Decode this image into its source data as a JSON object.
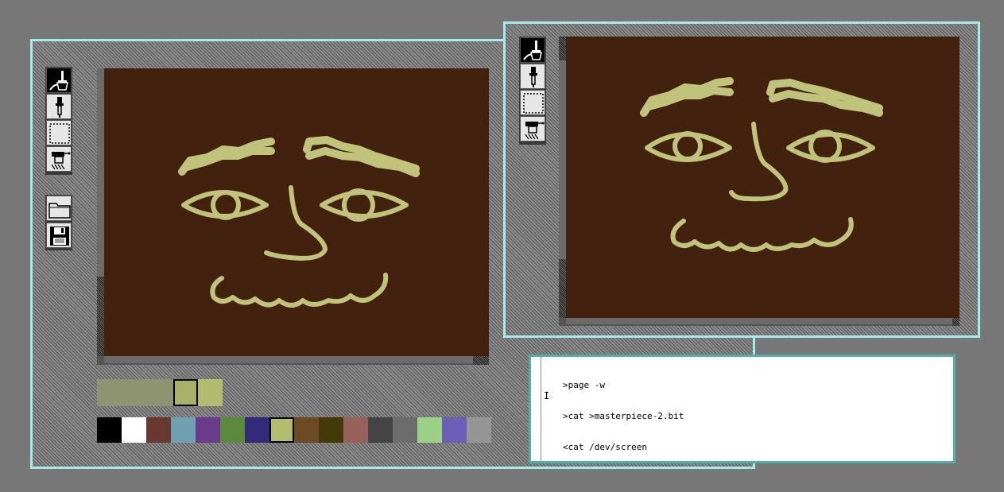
{
  "windows": {
    "left": {
      "tools": [
        {
          "icon": "paintbrush-icon",
          "selected": true
        },
        {
          "icon": "eyedropper-icon",
          "selected": false
        },
        {
          "icon": "marquee-select-icon",
          "selected": false
        },
        {
          "icon": "fill-tool-icon",
          "selected": false
        }
      ],
      "file_tools": [
        {
          "icon": "folder-open-icon"
        },
        {
          "icon": "floppy-disk-save-icon"
        }
      ],
      "current_colors": [
        "#8e9470",
        "#a9b06a",
        "#b2bc6e"
      ],
      "palette": [
        "#000000",
        "#ffffff",
        "#683a2f",
        "#6fa1b0",
        "#6a3b8c",
        "#5a8a3a",
        "#322a7a",
        "#b4bd6e",
        "#6b4a24",
        "#433a08",
        "#98625a",
        "#444444",
        "#6c6c6c",
        "#9ad184",
        "#6c5eb6",
        "#959595"
      ],
      "selected_palette_index": 7
    },
    "right": {
      "tools": [
        {
          "icon": "paintbrush-icon",
          "selected": true
        },
        {
          "icon": "eyedropper-icon",
          "selected": false
        },
        {
          "icon": "marquee-select-icon",
          "selected": false
        },
        {
          "icon": "fill-tool-icon",
          "selected": false
        }
      ]
    }
  },
  "colors": {
    "canvas_bg": "#42220f",
    "stroke": "#bfc47a",
    "window_border": "#a4ece8",
    "desktop": "#777777"
  },
  "terminal": {
    "lines": [
      ">page -w",
      ">cat >masterpiece-2.bit",
      "<cat /dev/screen"
    ],
    "cursor_glyph": "I"
  }
}
